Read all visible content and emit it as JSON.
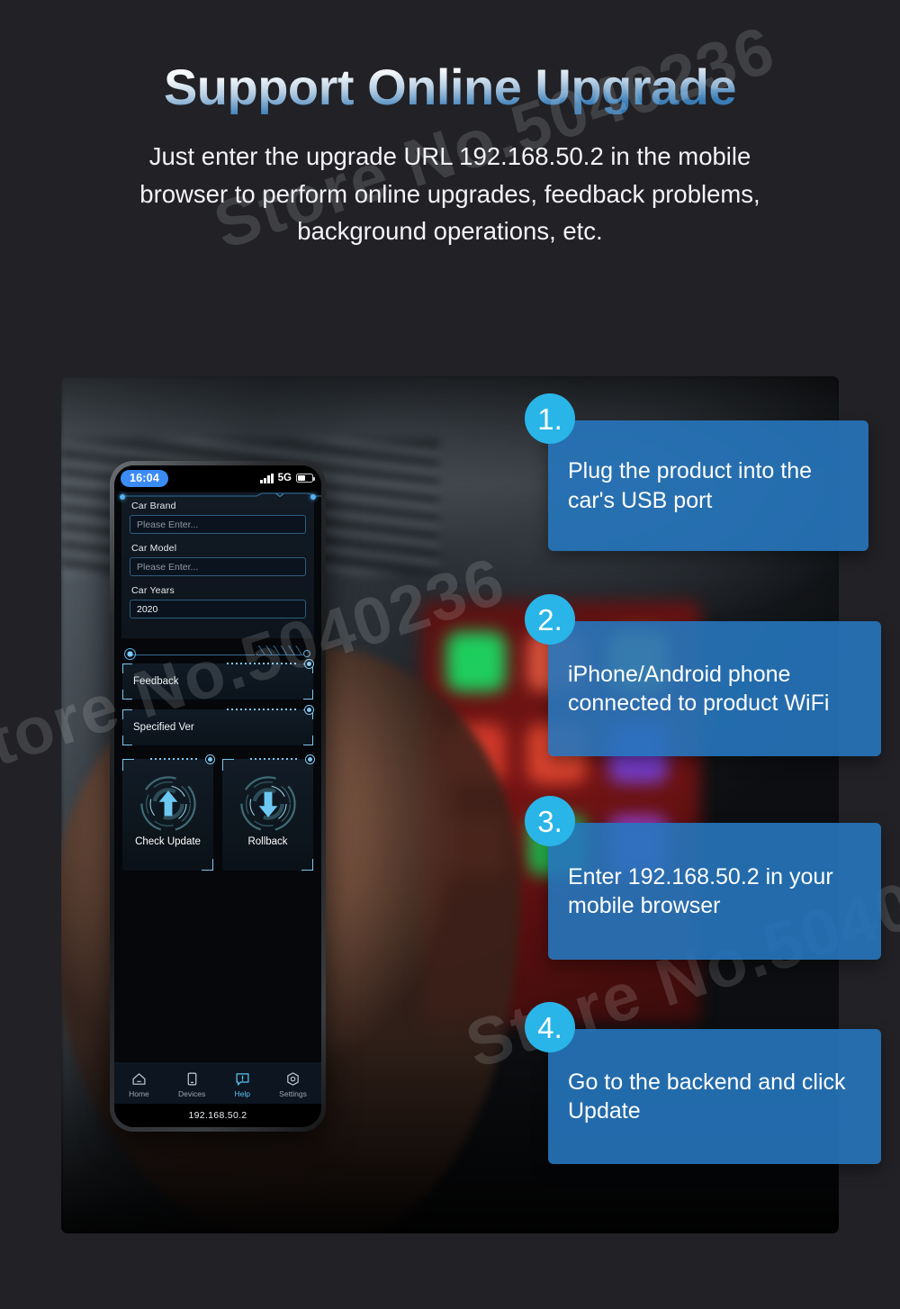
{
  "header": {
    "title": "Support Online Upgrade",
    "subtitle": "Just enter the upgrade URL 192.168.50.2 in the mobile browser to perform online upgrades, feedback problems, background operations, etc."
  },
  "watermark": {
    "text": "Store No.5040236"
  },
  "phone": {
    "status_bar": {
      "time": "16:04",
      "network": "5G"
    },
    "form": {
      "fields": [
        {
          "label": "Car Brand",
          "value": "",
          "placeholder": "Please Enter..."
        },
        {
          "label": "Car Model",
          "value": "",
          "placeholder": "Please Enter..."
        },
        {
          "label": "Car Years",
          "value": "2020",
          "placeholder": ""
        }
      ]
    },
    "buttons": [
      {
        "label": "Feedback"
      },
      {
        "label": "Specified Ver"
      }
    ],
    "tiles": [
      {
        "label": "Check Update",
        "icon": "arrow-up-icon"
      },
      {
        "label": "Rollback",
        "icon": "arrow-down-icon"
      }
    ],
    "nav": [
      {
        "label": "Home",
        "icon": "home-icon",
        "active": false
      },
      {
        "label": "Devices",
        "icon": "device-icon",
        "active": false
      },
      {
        "label": "Help",
        "icon": "help-chat-icon",
        "active": true
      },
      {
        "label": "Settings",
        "icon": "gear-hex-icon",
        "active": false
      }
    ],
    "url": "192.168.50.2"
  },
  "steps": [
    {
      "number": "1.",
      "text": "Plug the product into the car's USB port"
    },
    {
      "number": "2.",
      "text": "iPhone/Android phone connected to product WiFi"
    },
    {
      "number": "3.",
      "text": "Enter 192.168.50.2 in your mobile browser"
    },
    {
      "number": "4.",
      "text": "Go to the backend and click Update"
    }
  ],
  "colors": {
    "page_background": "#212126",
    "accent_blue": "#3b8bf5",
    "badge_cyan": "#29b5e8",
    "bubble_blue": "#2676bc",
    "hud_line": "#7fc7f2"
  }
}
